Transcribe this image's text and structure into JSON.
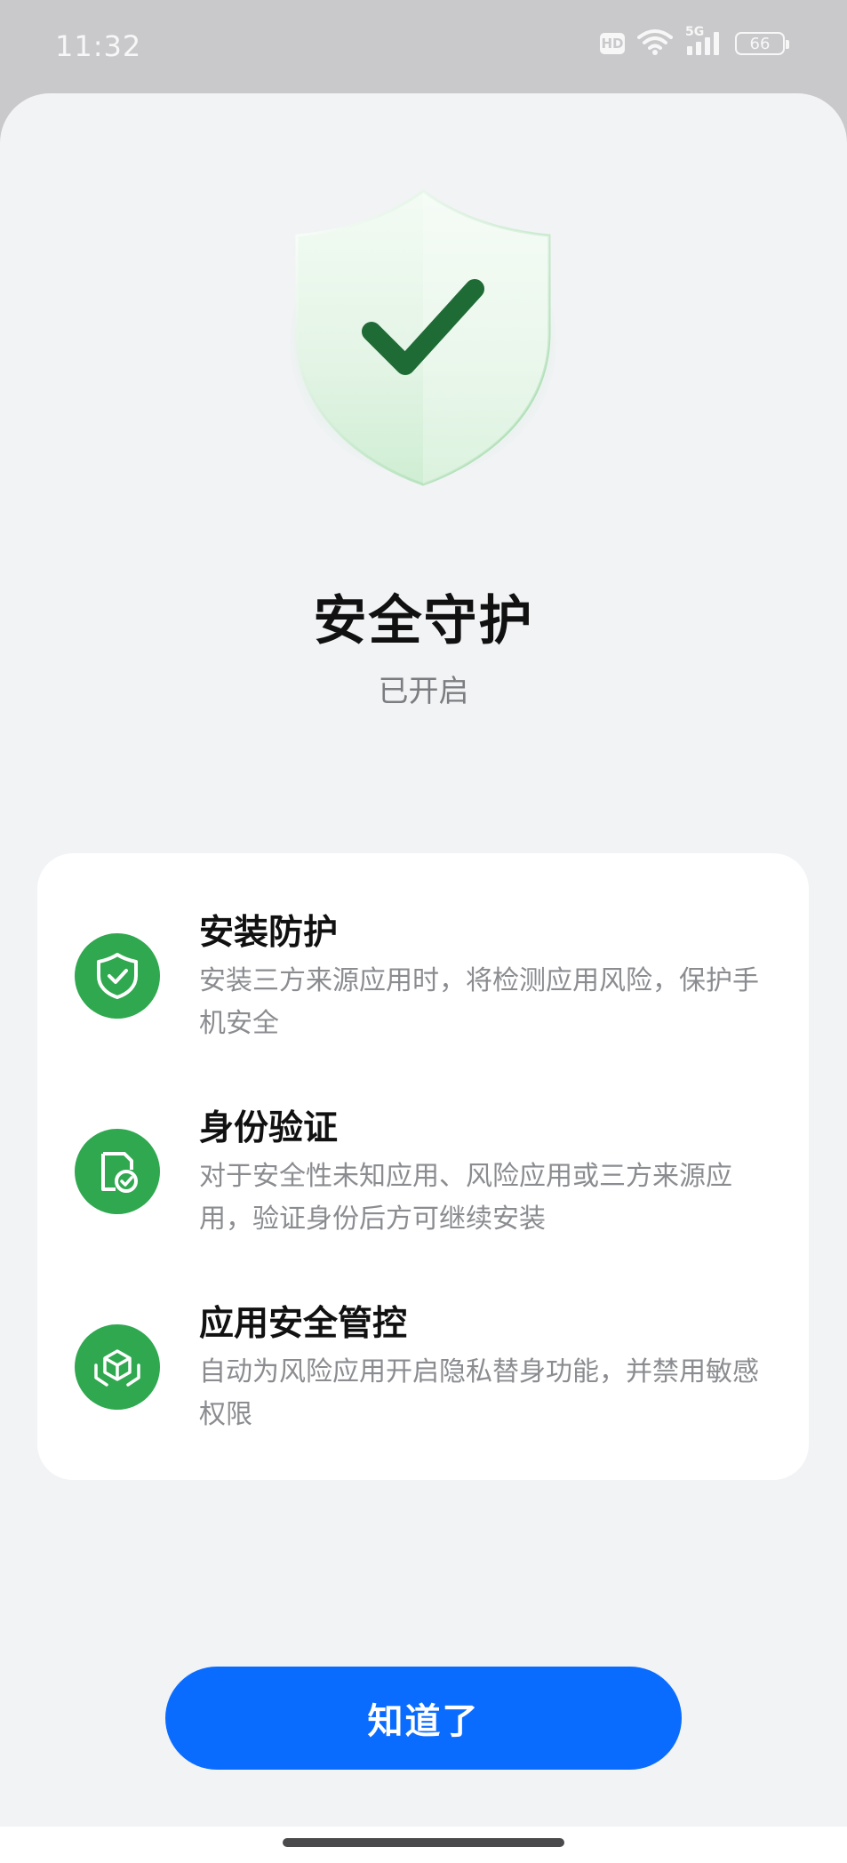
{
  "status_bar": {
    "time": "11:32",
    "hd_label": "HD",
    "network_label": "5G",
    "battery_level": "66"
  },
  "header": {
    "title": "安全守护",
    "subtitle": "已开启"
  },
  "features": [
    {
      "title": "安装防护",
      "description": "安装三方来源应用时，将检测应用风险，保护手机安全",
      "icon": "shield-check-icon"
    },
    {
      "title": "身份验证",
      "description": "对于安全性未知应用、风险应用或三方来源应用，验证身份后方可继续安装",
      "icon": "id-verify-icon"
    },
    {
      "title": "应用安全管控",
      "description": "自动为风险应用开启隐私替身功能，并禁用敏感权限",
      "icon": "app-control-icon"
    }
  ],
  "button": {
    "label": "知道了"
  },
  "colors": {
    "accent": "#0a6cff",
    "feature_icon_bg": "#2fa84f",
    "shield_check": "#1f6b36"
  }
}
